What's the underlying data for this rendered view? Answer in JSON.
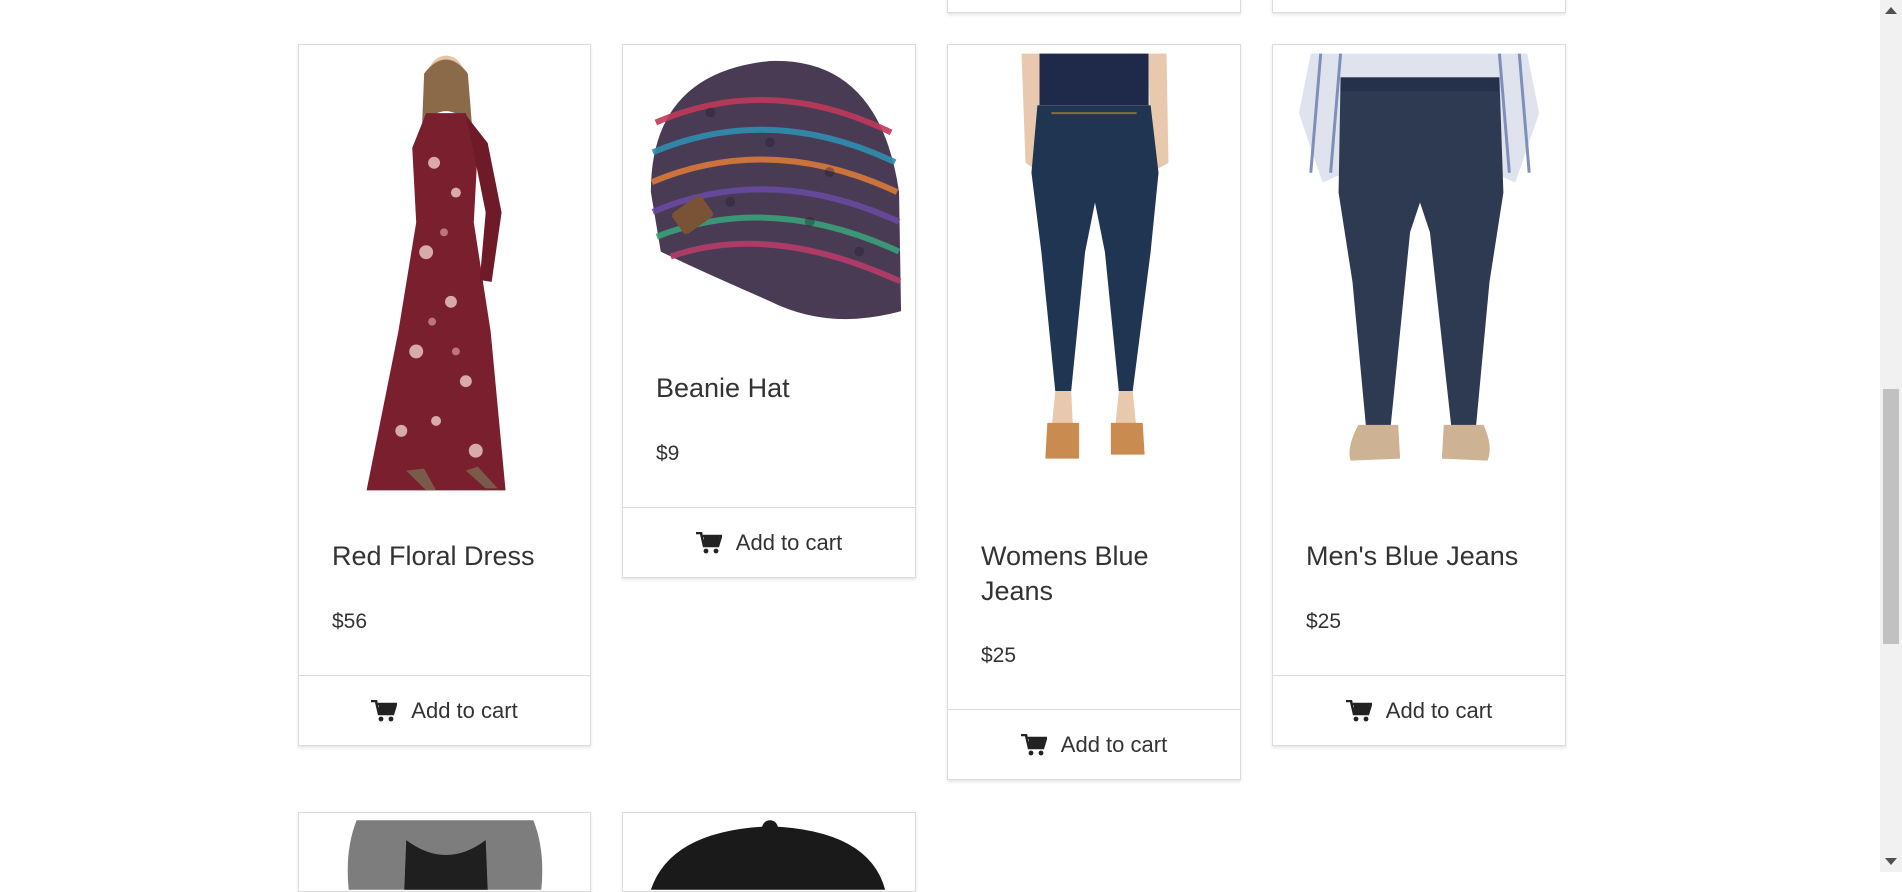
{
  "products": [
    {
      "title": "Red Floral Dress",
      "price": "$56",
      "cta": "Add to cart"
    },
    {
      "title": "Beanie Hat",
      "price": "$9",
      "cta": "Add to cart"
    },
    {
      "title": "Womens Blue Jeans",
      "price": "$25",
      "cta": "Add to cart"
    },
    {
      "title": "Men's Blue Jeans",
      "price": "$25",
      "cta": "Add to cart"
    }
  ],
  "icons": {
    "cart": "shopping-cart-icon"
  },
  "colors": {
    "text": "#333333",
    "border": "#dcdcdc",
    "dress": "#7a1f2e",
    "denim": "#1f3552",
    "trousers": "#2e3a52"
  }
}
